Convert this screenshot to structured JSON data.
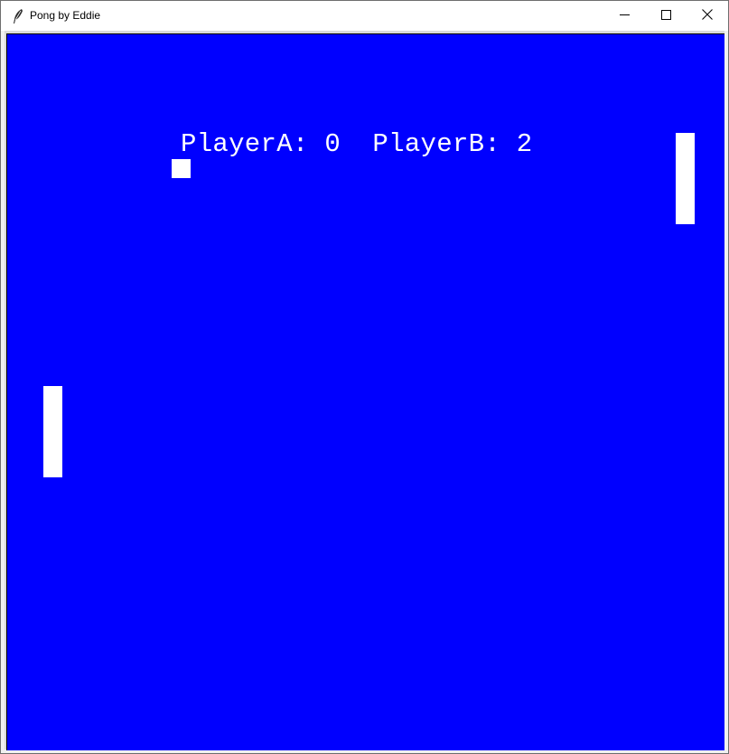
{
  "window": {
    "title": "Pong by Eddie",
    "icon": "feather-icon",
    "controls": {
      "minimize_icon": "minimize-icon",
      "maximize_icon": "maximize-icon",
      "close_icon": "close-icon"
    }
  },
  "game": {
    "background_color": "#0000ff",
    "foreground_color": "#ffffff",
    "score": {
      "text": "PlayerA: 0  PlayerB: 2",
      "player_a_score": 0,
      "player_b_score": 2
    }
  }
}
